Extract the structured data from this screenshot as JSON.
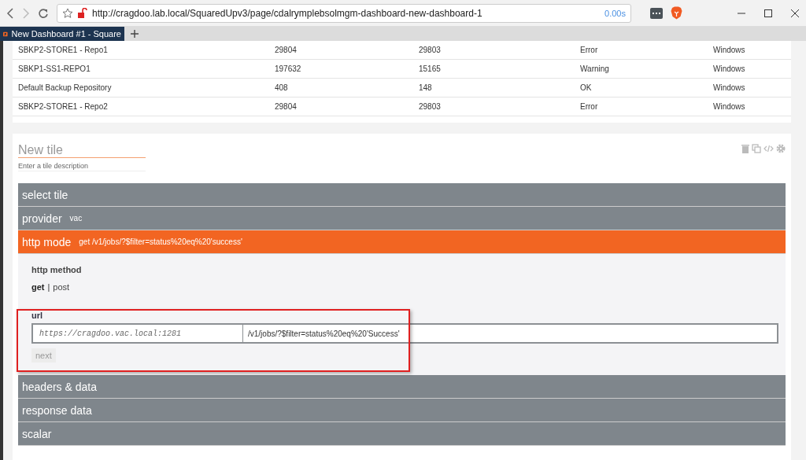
{
  "browser": {
    "url": "http://cragdoo.lab.local/SquaredUpv3/page/cdalrymplebsolmgm-dashboard-new-dashboard-1",
    "load_time": "0.00s",
    "tab_title": "New Dashboard #1 - Square"
  },
  "table": {
    "rows": [
      {
        "cells": [
          "SBKP2-STORE1 - Repo1",
          "29804",
          "29803",
          "Error",
          "Windows"
        ]
      },
      {
        "cells": [
          "SBKP1-SS1-REPO1",
          "197632",
          "15165",
          "Warning",
          "Windows"
        ]
      },
      {
        "cells": [
          "Default Backup Repository",
          "408",
          "148",
          "OK",
          "Windows"
        ]
      },
      {
        "cells": [
          "SBKP2-STORE1 - Repo2",
          "29804",
          "29803",
          "Error",
          "Windows"
        ]
      }
    ]
  },
  "tile": {
    "title_placeholder": "New tile",
    "description_placeholder": "Enter a tile description",
    "sections": [
      {
        "label": "select tile",
        "selected": false
      },
      {
        "label": "provider",
        "value": "vac",
        "selected": false
      },
      {
        "label": "http mode",
        "value": "get /v1/jobs/?$filter=status%20eq%20'success'",
        "selected": true
      },
      {
        "label": "headers & data",
        "selected": false
      },
      {
        "label": "response data",
        "selected": false
      },
      {
        "label": "scalar",
        "selected": false
      }
    ],
    "http_method_label": "http method",
    "methods": [
      {
        "label": "get",
        "selected": true
      },
      {
        "label": "post",
        "selected": false
      }
    ],
    "method_separator": "|",
    "url_label": "url",
    "base_url": "https://cragdoo.vac.local:1281",
    "path": "/v1/jobs/?$filter=status%20eq%20'Success'",
    "next_button": "next"
  }
}
